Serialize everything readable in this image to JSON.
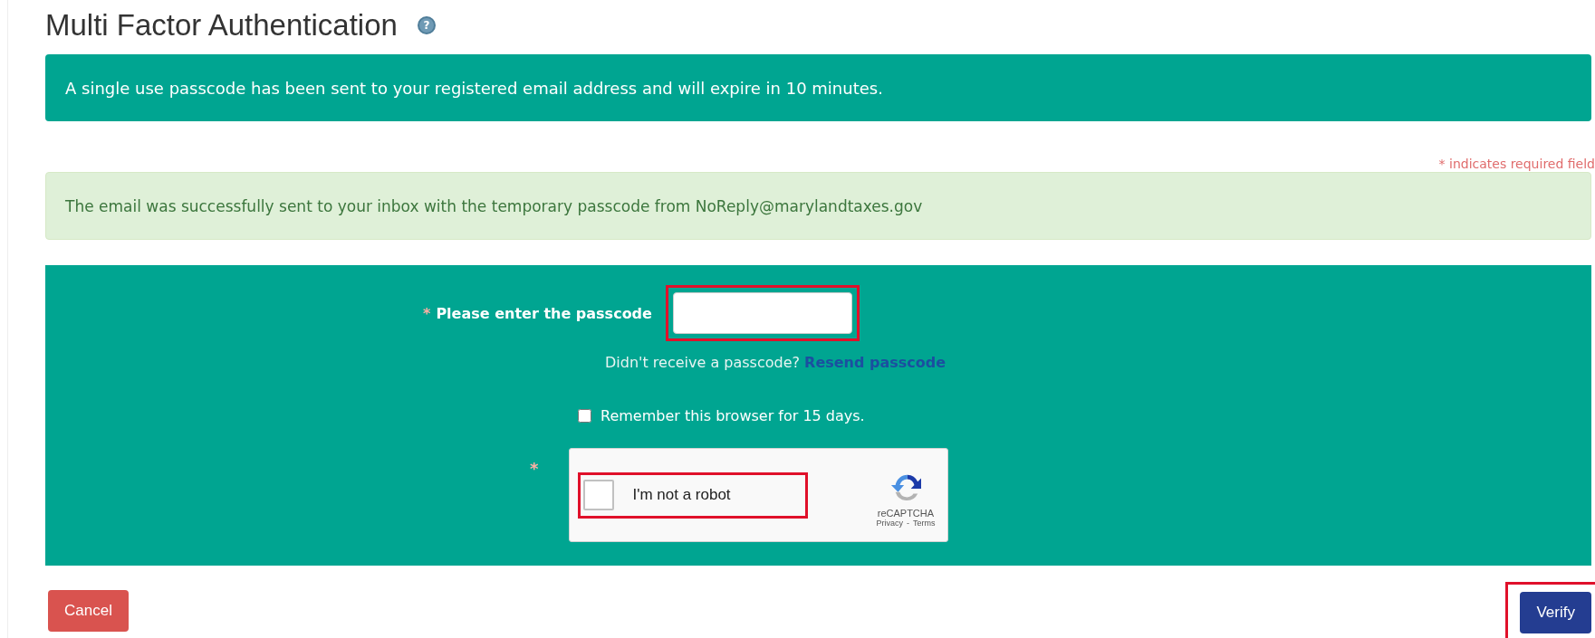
{
  "page": {
    "title": "Multi Factor Authentication",
    "help_glyph": "?"
  },
  "info_banner": "A single use passcode has been sent to your registered email address and will expire in 10 minutes.",
  "required_note": "* indicates required field",
  "success_alert": "The email was successfully sent to your inbox with the temporary passcode from NoReply@marylandtaxes.gov",
  "form": {
    "passcode": {
      "required_mark": "*",
      "label": "Please enter the passcode",
      "highlighted": true
    },
    "resend": {
      "text": "Didn't receive a passcode?",
      "link": "Resend passcode"
    },
    "remember": {
      "label": "Remember this browser for 15 days.",
      "checked": false
    },
    "captcha": {
      "required_mark": "*",
      "label": "I'm not a robot",
      "checked": false,
      "highlighted": true,
      "brand": "reCAPTCHA",
      "privacy": "Privacy",
      "separator": "-",
      "terms": "Terms"
    }
  },
  "buttons": [
    {
      "label": "Cancel",
      "kind": "danger",
      "highlighted": false
    },
    {
      "label": "Verify",
      "kind": "primary",
      "highlighted": true
    }
  ]
}
